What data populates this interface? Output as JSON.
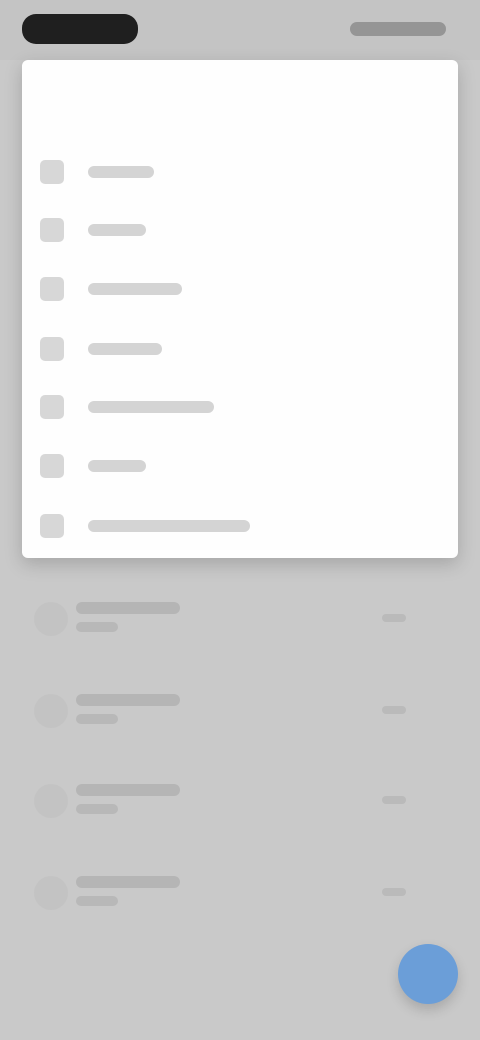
{
  "status_bar": {
    "time": "",
    "icons": [
      "signal-icon",
      "wifi-icon",
      "battery-icon"
    ]
  },
  "modal": {
    "title": "",
    "items": [
      {
        "label": "",
        "icon": "menu-item-icon"
      },
      {
        "label": "",
        "icon": "menu-item-icon"
      },
      {
        "label": "",
        "icon": "menu-item-icon"
      },
      {
        "label": "",
        "icon": "menu-item-icon"
      },
      {
        "label": "",
        "icon": "menu-item-icon"
      },
      {
        "label": "",
        "icon": "menu-item-icon"
      },
      {
        "label": "",
        "icon": "menu-item-icon"
      }
    ]
  },
  "list": {
    "items": [
      {
        "title": "",
        "subtitle": ""
      },
      {
        "title": "",
        "subtitle": ""
      },
      {
        "title": "",
        "subtitle": ""
      },
      {
        "title": "",
        "subtitle": ""
      }
    ]
  },
  "fab": {
    "label": "",
    "icon": "add-icon"
  },
  "colors": {
    "background": "#c9c9c9",
    "modal": "#fefefe",
    "fab": "#6b9ed8",
    "status_pill": "#1f1f1f"
  }
}
